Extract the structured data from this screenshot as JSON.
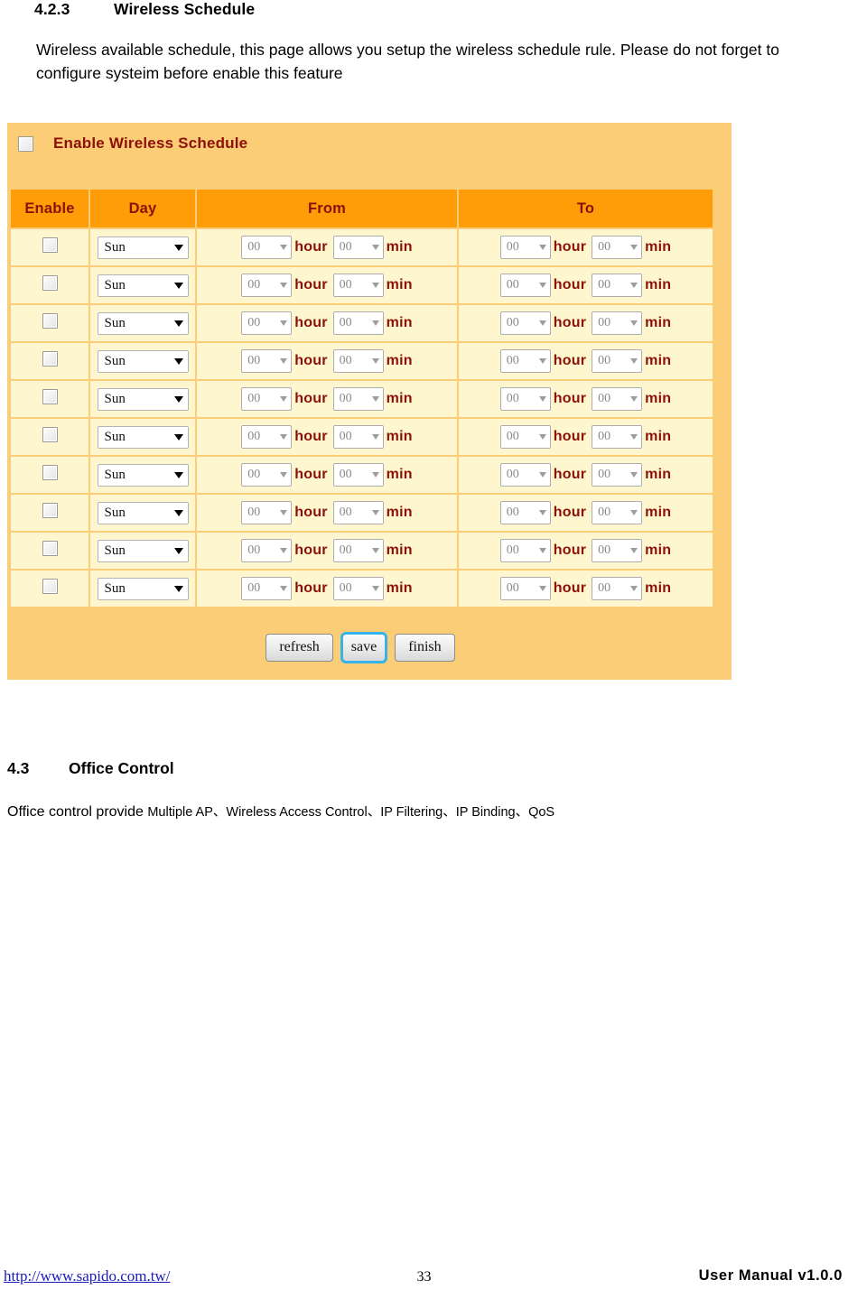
{
  "section": {
    "number": "4.2.3",
    "title": "Wireless Schedule",
    "description": "Wireless available schedule, this page allows you setup the wireless schedule rule. Please do not forget to configure systeim before enable this feature"
  },
  "panel": {
    "enable_checkbox_label": "Enable Wireless Schedule",
    "enable_checked": false,
    "colors": {
      "panel_bg": "#fbcd77",
      "header_bg": "#ff9d08",
      "row_bg": "#fdf6cf",
      "header_text": "#8d1008"
    },
    "table": {
      "headers": [
        "Enable",
        "Day",
        "From",
        "To"
      ],
      "unit_hour": "hour",
      "unit_min": "min",
      "rows": [
        {
          "enabled": false,
          "day": "Sun",
          "from_hour": "00",
          "from_min": "00",
          "to_hour": "00",
          "to_min": "00"
        },
        {
          "enabled": false,
          "day": "Sun",
          "from_hour": "00",
          "from_min": "00",
          "to_hour": "00",
          "to_min": "00"
        },
        {
          "enabled": false,
          "day": "Sun",
          "from_hour": "00",
          "from_min": "00",
          "to_hour": "00",
          "to_min": "00"
        },
        {
          "enabled": false,
          "day": "Sun",
          "from_hour": "00",
          "from_min": "00",
          "to_hour": "00",
          "to_min": "00"
        },
        {
          "enabled": false,
          "day": "Sun",
          "from_hour": "00",
          "from_min": "00",
          "to_hour": "00",
          "to_min": "00"
        },
        {
          "enabled": false,
          "day": "Sun",
          "from_hour": "00",
          "from_min": "00",
          "to_hour": "00",
          "to_min": "00"
        },
        {
          "enabled": false,
          "day": "Sun",
          "from_hour": "00",
          "from_min": "00",
          "to_hour": "00",
          "to_min": "00"
        },
        {
          "enabled": false,
          "day": "Sun",
          "from_hour": "00",
          "from_min": "00",
          "to_hour": "00",
          "to_min": "00"
        },
        {
          "enabled": false,
          "day": "Sun",
          "from_hour": "00",
          "from_min": "00",
          "to_hour": "00",
          "to_min": "00"
        },
        {
          "enabled": false,
          "day": "Sun",
          "from_hour": "00",
          "from_min": "00",
          "to_hour": "00",
          "to_min": "00"
        }
      ]
    },
    "buttons": {
      "refresh": "refresh",
      "save": "save",
      "finish": "finish"
    }
  },
  "section2": {
    "number": "4.3",
    "title": "Office Control",
    "description_lead": "Office control provide ",
    "description_items": "Multiple AP、Wireless Access Control、IP Filtering、IP Binding、QoS"
  },
  "footer": {
    "url": "http://www.sapido.com.tw/",
    "page_number": "33",
    "manual": "User  Manual  v1.0.0"
  }
}
